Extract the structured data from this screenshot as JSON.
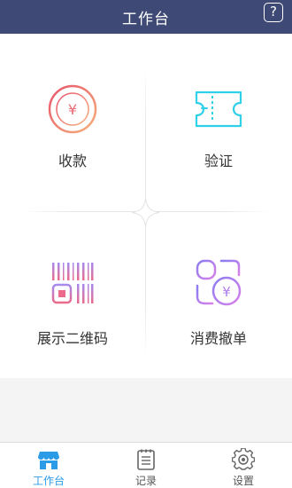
{
  "header": {
    "title": "工作台",
    "help_label": "?"
  },
  "grid": {
    "items": [
      {
        "label": "收款",
        "icon": "payment-icon"
      },
      {
        "label": "验证",
        "icon": "ticket-verify-icon"
      },
      {
        "label": "展示二维码",
        "icon": "qrcode-icon"
      },
      {
        "label": "消费撤单",
        "icon": "refund-icon"
      }
    ]
  },
  "tabbar": {
    "tabs": [
      {
        "label": "工作台",
        "icon": "store-icon",
        "active": true
      },
      {
        "label": "记录",
        "icon": "notebook-icon",
        "active": false
      },
      {
        "label": "设置",
        "icon": "gear-icon",
        "active": false
      }
    ]
  },
  "colors": {
    "header_bg": "#3e4a75",
    "accent": "#2b9be8",
    "payment_gradient": [
      "#e8546c",
      "#f5b07a"
    ],
    "verify": "#2fd0e8",
    "qrcode_gradient": [
      "#a68bf0",
      "#ec6a8c"
    ],
    "refund_gradient": [
      "#8b7cf2",
      "#d880e8"
    ]
  }
}
